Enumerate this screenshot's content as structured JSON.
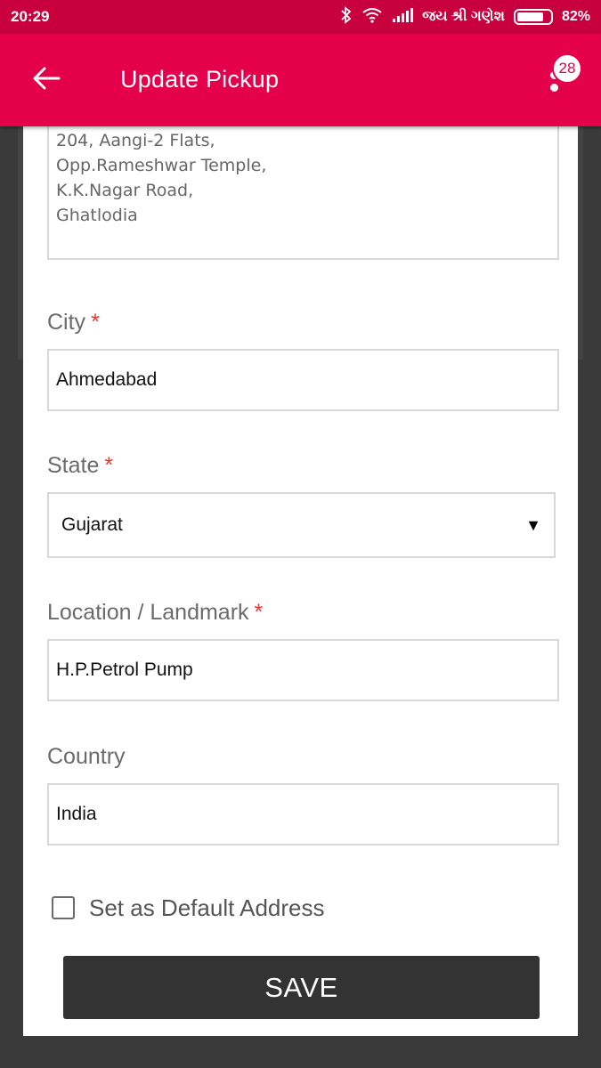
{
  "status_bar": {
    "time": "20:29",
    "carrier": "જય શ્રી ગણેશ",
    "battery": "82%",
    "battery_level": 0.82
  },
  "app_bar": {
    "title": "Update Pickup",
    "notification_count": "28"
  },
  "form": {
    "address_lines": [
      "204, Aangi-2 Flats,",
      "Opp.Rameshwar Temple,",
      "K.K.Nagar Road,",
      "Ghatlodia"
    ],
    "city": {
      "label": "City",
      "required": "*",
      "value": "Ahmedabad"
    },
    "state": {
      "label": "State",
      "required": "*",
      "value": "Gujarat"
    },
    "landmark": {
      "label": "Location / Landmark",
      "required": "*",
      "value": "H.P.Petrol Pump"
    },
    "country": {
      "label": "Country",
      "value": "India"
    },
    "default_checkbox": {
      "label": "Set as Default Address",
      "checked": false
    },
    "save_label": "SAVE"
  },
  "icons": {
    "back": "arrow-left-icon",
    "menu": "more-vert-icon",
    "bluetooth": "bluetooth-icon",
    "wifi": "wifi-icon",
    "signal": "signal-icon",
    "battery": "battery-icon",
    "dropdown": "caret-down-icon"
  },
  "colors": {
    "app_bar": "#e4004a",
    "status_bar": "#c8003e",
    "required": "#e53935",
    "save_button": "#333333"
  }
}
